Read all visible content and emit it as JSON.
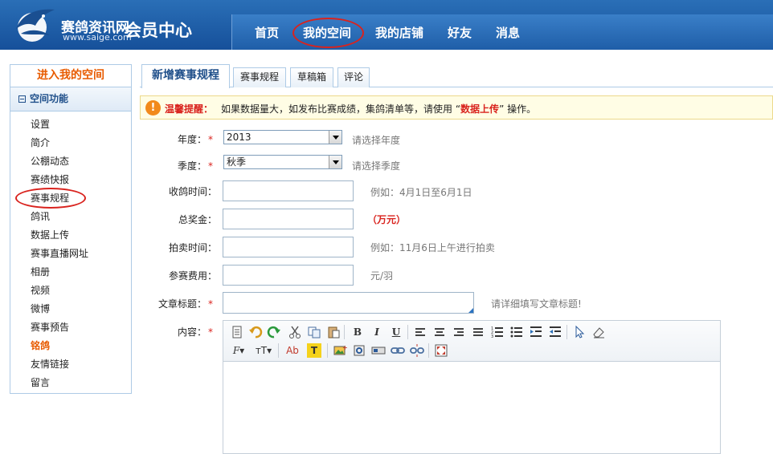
{
  "header": {
    "site_name": "赛鸽资讯网",
    "site_url": "www.saige.com",
    "section_title": "会员中心",
    "nav": [
      {
        "label": "首页"
      },
      {
        "label": "我的空间"
      },
      {
        "label": "我的店铺"
      },
      {
        "label": "好友"
      },
      {
        "label": "消息"
      }
    ]
  },
  "sidebar": {
    "title": "进入我的空间",
    "section": "空间功能",
    "items": [
      {
        "label": "设置"
      },
      {
        "label": "简介"
      },
      {
        "label": "公棚动态"
      },
      {
        "label": "赛绩快报"
      },
      {
        "label": "赛事规程"
      },
      {
        "label": "鸽讯"
      },
      {
        "label": "数据上传"
      },
      {
        "label": "赛事直播网址"
      },
      {
        "label": "相册"
      },
      {
        "label": "视频"
      },
      {
        "label": "微博"
      },
      {
        "label": "赛事预告"
      },
      {
        "label": "铭鸽"
      },
      {
        "label": "友情链接"
      },
      {
        "label": "留言"
      }
    ],
    "active_index": 12
  },
  "tabs": [
    {
      "label": "新增赛事规程"
    },
    {
      "label": "赛事规程"
    },
    {
      "label": "草稿箱"
    },
    {
      "label": "评论"
    }
  ],
  "notice": {
    "icon": "!",
    "label": "温馨提醒：",
    "text_before": "如果数据量大，如发布比赛成绩，集鸽清单等，请使用 “",
    "highlight": "数据上传",
    "text_after": "” 操作。"
  },
  "form": {
    "required_mark": "*",
    "year": {
      "label": "年度：",
      "value": "2013",
      "hint": "请选择年度"
    },
    "season": {
      "label": "季度：",
      "value": "秋季",
      "hint": "请选择季度"
    },
    "collect_time": {
      "label": "收鸽时间：",
      "value": "",
      "hint": "例如：4月1日至6月1日"
    },
    "prize": {
      "label": "总奖金：",
      "value": "",
      "hint": "（万元）"
    },
    "auction_time": {
      "label": "拍卖时间：",
      "value": "",
      "hint": "例如：11月6日上午进行拍卖"
    },
    "fee": {
      "label": "参赛费用：",
      "value": "",
      "hint": "元/羽"
    },
    "article_title": {
      "label": "文章标题：",
      "value": "",
      "hint": "请详细填写文章标题!"
    },
    "content": {
      "label": "内容："
    }
  },
  "editor": {
    "bold": "B",
    "italic": "I",
    "underline": "U",
    "font_family": "F",
    "font_size": "тT",
    "font_color": "Ab",
    "highlight": "T"
  }
}
